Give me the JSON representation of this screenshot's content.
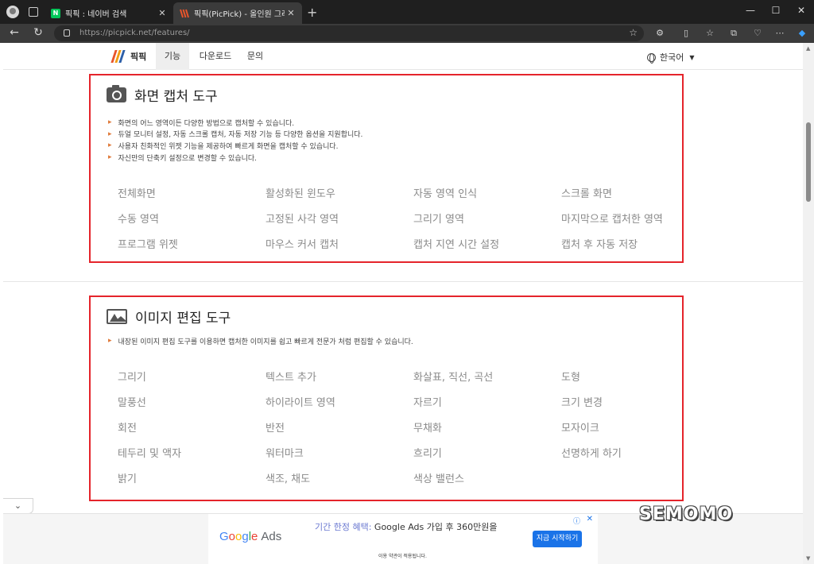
{
  "browser": {
    "tabs": [
      {
        "favicon": "N",
        "title": "픽픽 : 네이버 검색",
        "close": "✕"
      },
      {
        "favicon": "picpick",
        "title": "픽픽(PicPick) - 올인원 그래픽 디자인",
        "close": "✕"
      }
    ],
    "new_tab": "+",
    "window_controls": {
      "minimize": "—",
      "maximize": "☐",
      "close": "✕"
    },
    "url": "https://picpick.net/features/",
    "nav": {
      "back": "←",
      "refresh": "↻"
    }
  },
  "site": {
    "logo_text": "픽픽",
    "logo_colors": [
      "#e8552b",
      "#f39c12",
      "#2e5fa8"
    ],
    "nav_items": [
      "기능",
      "다운로드",
      "문의"
    ],
    "language": "한국어"
  },
  "capture": {
    "title": "화면 캡처 도구",
    "bullets": [
      "화면의 어느 영역이든 다양한 방법으로 캡처할 수 있습니다.",
      "듀얼 모니터 설정, 자동 스크롤 캡처, 자동 저장 기능 등 다양한 옵션을 지원합니다.",
      "사용자 친화적인 위젯 기능을 제공하여 빠르게 화면을 캡처할 수 있습니다.",
      "자신만의 단축키 설정으로 변경할 수 있습니다."
    ],
    "features": [
      "전체화면",
      "활성화된 윈도우",
      "자동 영역 인식",
      "스크롤 화면",
      "수동 영역",
      "고정된 사각 영역",
      "그리기 영역",
      "마지막으로 캡처한 영역",
      "프로그램 위젯",
      "마우스 커서 캡처",
      "캡처 지연 시간 설정",
      "캡처 후 자동 저장"
    ]
  },
  "editor": {
    "title": "이미지 편집 도구",
    "bullets": [
      "내장된 이미지 편집 도구를 이용하면 캡처한 이미지를 쉽고 빠르게 전문가 처럼 편집할 수 있습니다."
    ],
    "features": [
      "그리기",
      "텍스트 추가",
      "화살표, 직선, 곡선",
      "도형",
      "말풍선",
      "하이라이트 영역",
      "자르기",
      "크기 변경",
      "회전",
      "반전",
      "무채화",
      "모자이크",
      "테두리 및 액자",
      "워터마크",
      "흐리기",
      "선명하게 하기",
      "밝기",
      "색조, 채도",
      "색상 밸런스"
    ]
  },
  "collapse_icon": "chevron-down-icon",
  "ad": {
    "logo_parts": [
      "G",
      "o",
      "o",
      "g",
      "l",
      "e"
    ],
    "logo_suffix": "Ads",
    "headline_highlight": "기간 한정 혜택:",
    "headline_rest": " Google Ads 가입 후 360만원을",
    "cta": "지금 시작하기",
    "terms": "이용 약관이 적용됩니다.",
    "info": "ⓘ",
    "close": "✕"
  },
  "watermark": "SEMOMO"
}
